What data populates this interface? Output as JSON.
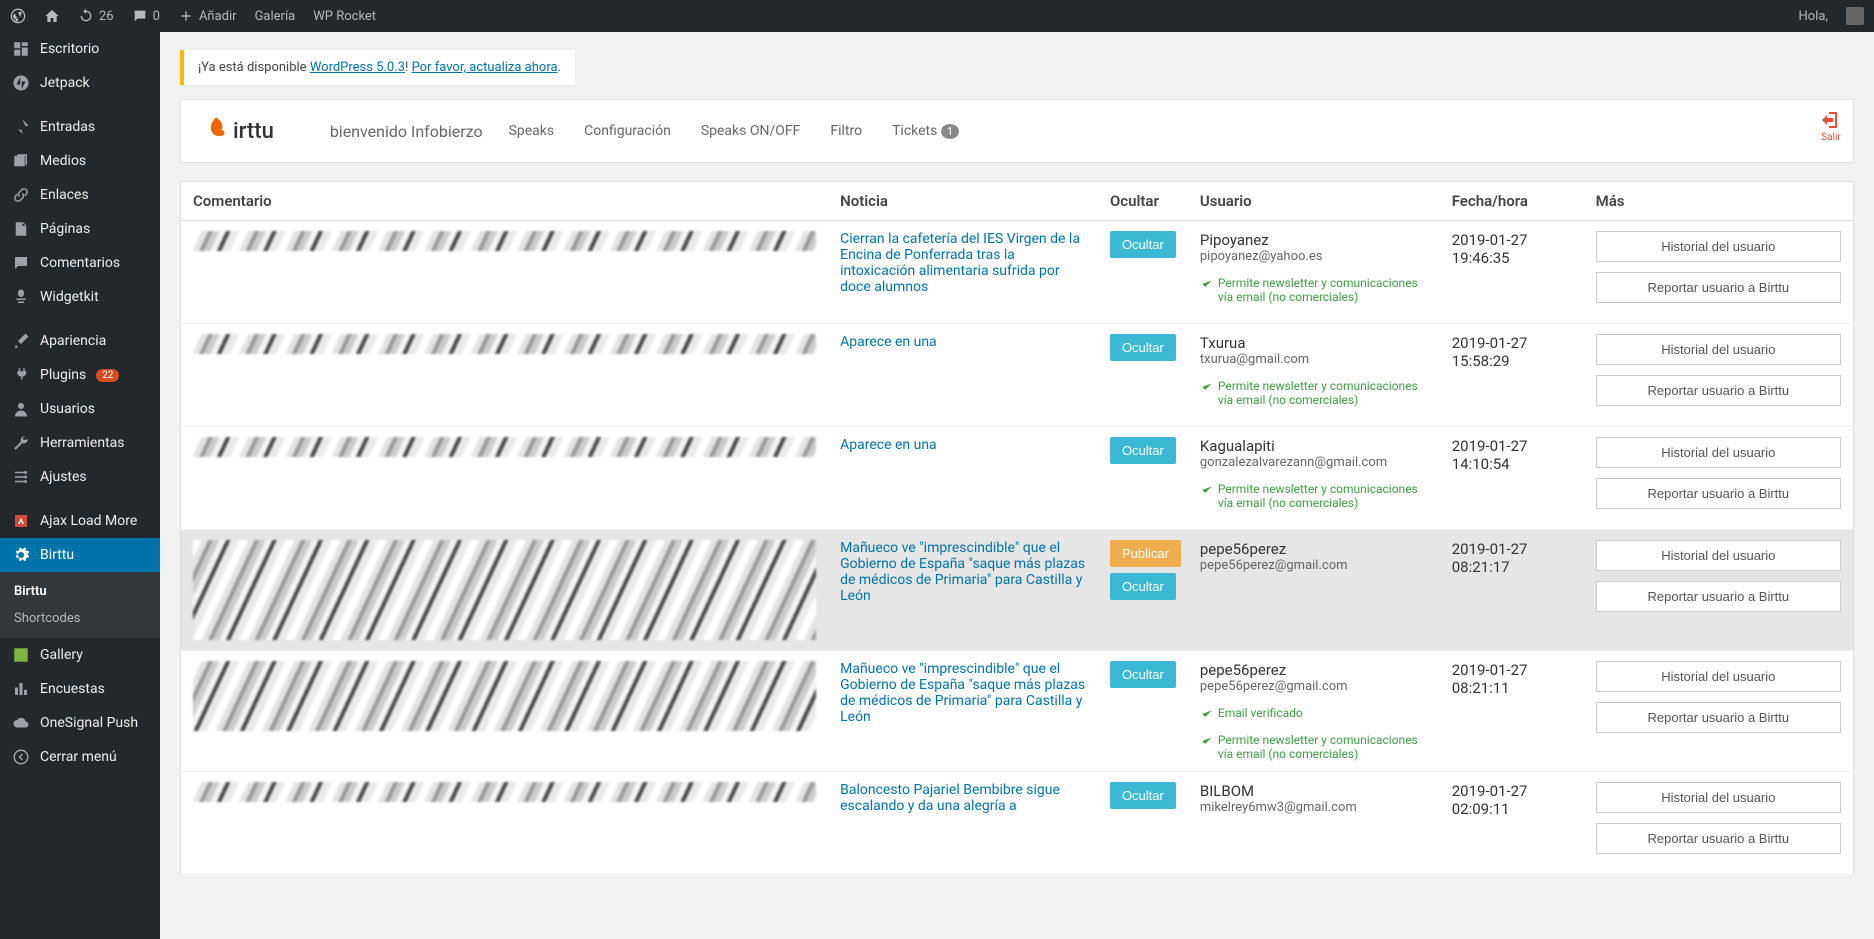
{
  "admin_bar": {
    "updates_count": "26",
    "comments_count": "0",
    "add_label": "Añadir",
    "gallery_label": "Galería",
    "wprocket_label": "WP Rocket",
    "greeting": "Hola,"
  },
  "sidebar": {
    "items": [
      {
        "label": "Escritorio",
        "icon": "dashboard"
      },
      {
        "label": "Jetpack",
        "icon": "jetpack"
      },
      {
        "label": "Entradas",
        "icon": "pin"
      },
      {
        "label": "Medios",
        "icon": "media"
      },
      {
        "label": "Enlaces",
        "icon": "link"
      },
      {
        "label": "Páginas",
        "icon": "page"
      },
      {
        "label": "Comentarios",
        "icon": "comment"
      },
      {
        "label": "Widgetkit",
        "icon": "widget"
      },
      {
        "label": "Apariencia",
        "icon": "brush"
      },
      {
        "label": "Plugins",
        "icon": "plug",
        "badge": "22"
      },
      {
        "label": "Usuarios",
        "icon": "user"
      },
      {
        "label": "Herramientas",
        "icon": "tool"
      },
      {
        "label": "Ajustes",
        "icon": "settings"
      },
      {
        "label": "Ajax Load More",
        "icon": "alm"
      },
      {
        "label": "Birttu",
        "icon": "gear",
        "active": true
      },
      {
        "label": "Gallery",
        "icon": "gallery"
      },
      {
        "label": "Encuestas",
        "icon": "poll"
      },
      {
        "label": "OneSignal Push",
        "icon": "cloud"
      },
      {
        "label": "Cerrar menú",
        "icon": "collapse"
      }
    ],
    "sub": {
      "birttu": "Birttu",
      "shortcodes": "Shortcodes"
    }
  },
  "notice": {
    "prefix": "¡Ya está disponible ",
    "link1": "WordPress 5.0.3",
    "mid": "! ",
    "link2": "Por favor, actualiza ahora",
    "suffix": "."
  },
  "plugin": {
    "name": "irttu",
    "welcome": "bienvenido Infobierzo",
    "nav": {
      "speaks": "Speaks",
      "config": "Configuración",
      "onoff": "Speaks ON/OFF",
      "filtro": "Filtro",
      "tickets": "Tickets",
      "tickets_count": "1"
    },
    "logout": "Salir"
  },
  "table": {
    "headers": {
      "comment": "Comentario",
      "news": "Noticia",
      "hide": "Ocultar",
      "user": "Usuario",
      "date": "Fecha/hora",
      "more": "Más"
    },
    "labels": {
      "ocultar": "Ocultar",
      "publicar": "Publicar",
      "historial": "Historial del usuario",
      "reportar": "Reportar usuario a Birttu",
      "permit": "Permite newsletter y comunicaciones vía email (no comerciales)",
      "email_verified": "Email verificado"
    },
    "rows": [
      {
        "news": "Cierran la cafetería del IES Virgen de la Encina de Ponferrada tras la intoxicación alimentaria sufrida por doce alumnos",
        "user": "Pipoyanez",
        "mail": "pipoyanez@yahoo.es",
        "date": "2019-01-27 19:46:35",
        "permit": true,
        "comment_height": "short"
      },
      {
        "news": "Aparece en una",
        "user": "Txurua",
        "mail": "txurua@gmail.com",
        "date": "2019-01-27 15:58:29",
        "permit": true,
        "comment_height": "short"
      },
      {
        "news": "Aparece en una",
        "user": "Kagualapiti",
        "mail": "gonzalezalvarezann@gmail.com",
        "date": "2019-01-27 14:10:54",
        "permit": true,
        "comment_height": "short"
      },
      {
        "news": "Mañueco ve \"imprescindible\" que el Gobierno de España \"saque más plazas de médicos de Primaria\" para Castilla y León",
        "user": "pepe56perez",
        "mail": "pepe56perez@gmail.com",
        "date": "2019-01-27 08:21:17",
        "muted": true,
        "publicar": true,
        "comment_height": "tall"
      },
      {
        "news": "Mañueco ve \"imprescindible\" que el Gobierno de España \"saque más plazas de médicos de Primaria\" para Castilla y León",
        "user": "pepe56perez",
        "mail": "pepe56perez@gmail.com",
        "date": "2019-01-27 08:21:11",
        "permit": true,
        "email_verified": true,
        "comment_height": "med"
      },
      {
        "news": "Baloncesto Pajariel Bembibre sigue escalando y da una alegría a",
        "user": "BILBOM",
        "mail": "mikelrey6mw3@gmail.com",
        "date": "2019-01-27 02:09:11",
        "comment_height": "short"
      }
    ]
  }
}
